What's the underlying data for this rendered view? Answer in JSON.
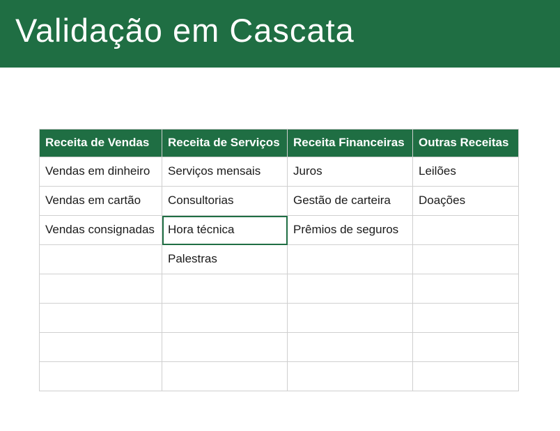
{
  "header": {
    "title": "Validação em Cascata"
  },
  "table": {
    "headers": [
      "Receita de Vendas",
      "Receita de Serviços",
      "Receita Financeiras",
      "Outras Receitas"
    ],
    "rows": [
      [
        "Vendas em dinheiro",
        "Serviços mensais",
        "Juros",
        "Leilões"
      ],
      [
        "Vendas em cartão",
        "Consultorias",
        "Gestão de carteira",
        "Doações"
      ],
      [
        "Vendas consignadas",
        "Hora técnica",
        "Prêmios de seguros",
        ""
      ],
      [
        "",
        "Palestras",
        "",
        ""
      ],
      [
        "",
        "",
        "",
        ""
      ],
      [
        "",
        "",
        "",
        ""
      ],
      [
        "",
        "",
        "",
        ""
      ],
      [
        "",
        "",
        "",
        ""
      ]
    ],
    "selected": {
      "row": 2,
      "col": 1
    }
  }
}
